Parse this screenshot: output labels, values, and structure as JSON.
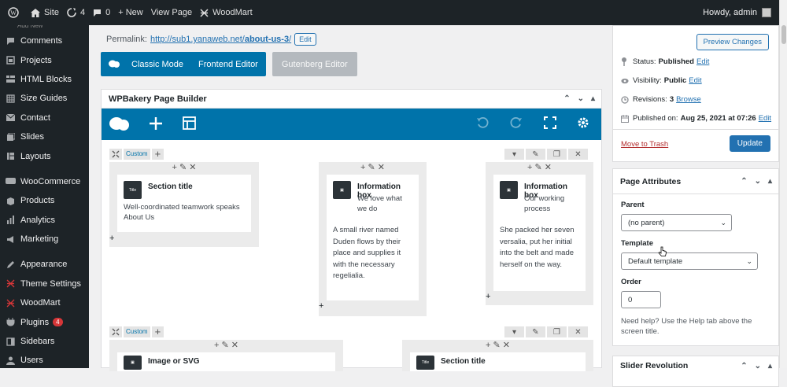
{
  "adminbar": {
    "site": "Site",
    "updates": "4",
    "comments": "0",
    "new": "+ New",
    "view_page": "View Page",
    "woodmart": "WoodMart",
    "greeting": "Howdy, admin"
  },
  "sidebar": {
    "partial_top": "Add New",
    "items": [
      {
        "label": "Comments",
        "icon": "comment-icon"
      },
      {
        "label": "Projects",
        "icon": "projects-icon"
      },
      {
        "label": "HTML Blocks",
        "icon": "html-blocks-icon"
      },
      {
        "label": "Size Guides",
        "icon": "size-guides-icon"
      },
      {
        "label": "Contact",
        "icon": "contact-icon"
      },
      {
        "label": "Slides",
        "icon": "slides-icon"
      },
      {
        "label": "Layouts",
        "icon": "layouts-icon"
      },
      {
        "label": "WooCommerce",
        "icon": "woocommerce-icon"
      },
      {
        "label": "Products",
        "icon": "products-icon"
      },
      {
        "label": "Analytics",
        "icon": "analytics-icon"
      },
      {
        "label": "Marketing",
        "icon": "marketing-icon"
      },
      {
        "label": "Appearance",
        "icon": "appearance-icon"
      },
      {
        "label": "Theme Settings",
        "icon": "theme-settings-icon"
      },
      {
        "label": "WoodMart",
        "icon": "woodmart-icon"
      },
      {
        "label": "Plugins",
        "icon": "plugins-icon",
        "badge": "4"
      },
      {
        "label": "Sidebars",
        "icon": "sidebars-icon"
      },
      {
        "label": "Users",
        "icon": "users-icon"
      }
    ]
  },
  "permalink": {
    "label": "Permalink:",
    "url_prefix": "http://sub1.yanaweb.net/",
    "slug": "about-us-3",
    "url_suffix": "/",
    "edit": "Edit"
  },
  "modes": {
    "classic": "Classic Mode",
    "frontend": "Frontend Editor",
    "gutenberg": "Gutenberg Editor"
  },
  "wpbakery": {
    "title": "WPBakery Page Builder",
    "custom": "Custom",
    "plus": "+",
    "row1": {
      "c1": {
        "title": "Section title",
        "text": "Well-coordinated teamwork speaks About Us",
        "icon_label": "Title"
      },
      "c2": {
        "title": "Information box",
        "text": "We love what we do",
        "text2": "A small river named Duden flows by their place and supplies it with the necessary regelialia."
      },
      "c3": {
        "title": "Information box",
        "text": "Our working process",
        "text2": "She packed her seven versalia, put her initial into the belt and made herself on the way."
      }
    },
    "row2": {
      "c1": {
        "title": "Image or SVG"
      },
      "c2": {
        "title": "Section title",
        "icon_label": "Title"
      }
    }
  },
  "publish": {
    "preview": "Preview Changes",
    "status_label": "Status:",
    "status": "Published",
    "visibility_label": "Visibility:",
    "visibility": "Public",
    "revisions_label": "Revisions:",
    "revisions": "3",
    "browse": "Browse",
    "published_label": "Published on:",
    "published": "Aug 25, 2021 at 07:26",
    "edit": "Edit",
    "trash": "Move to Trash",
    "update": "Update"
  },
  "attributes": {
    "title": "Page Attributes",
    "parent_label": "Parent",
    "parent_value": "(no parent)",
    "template_label": "Template",
    "template_value": "Default template",
    "order_label": "Order",
    "order_value": "0",
    "help": "Need help? Use the Help tab above the screen title."
  },
  "slider": {
    "title": "Slider Revolution"
  },
  "colors": {
    "wp_blue": "#0073aa",
    "admin_dark": "#1d2327",
    "link": "#2271b1",
    "danger": "#b32d2e"
  }
}
